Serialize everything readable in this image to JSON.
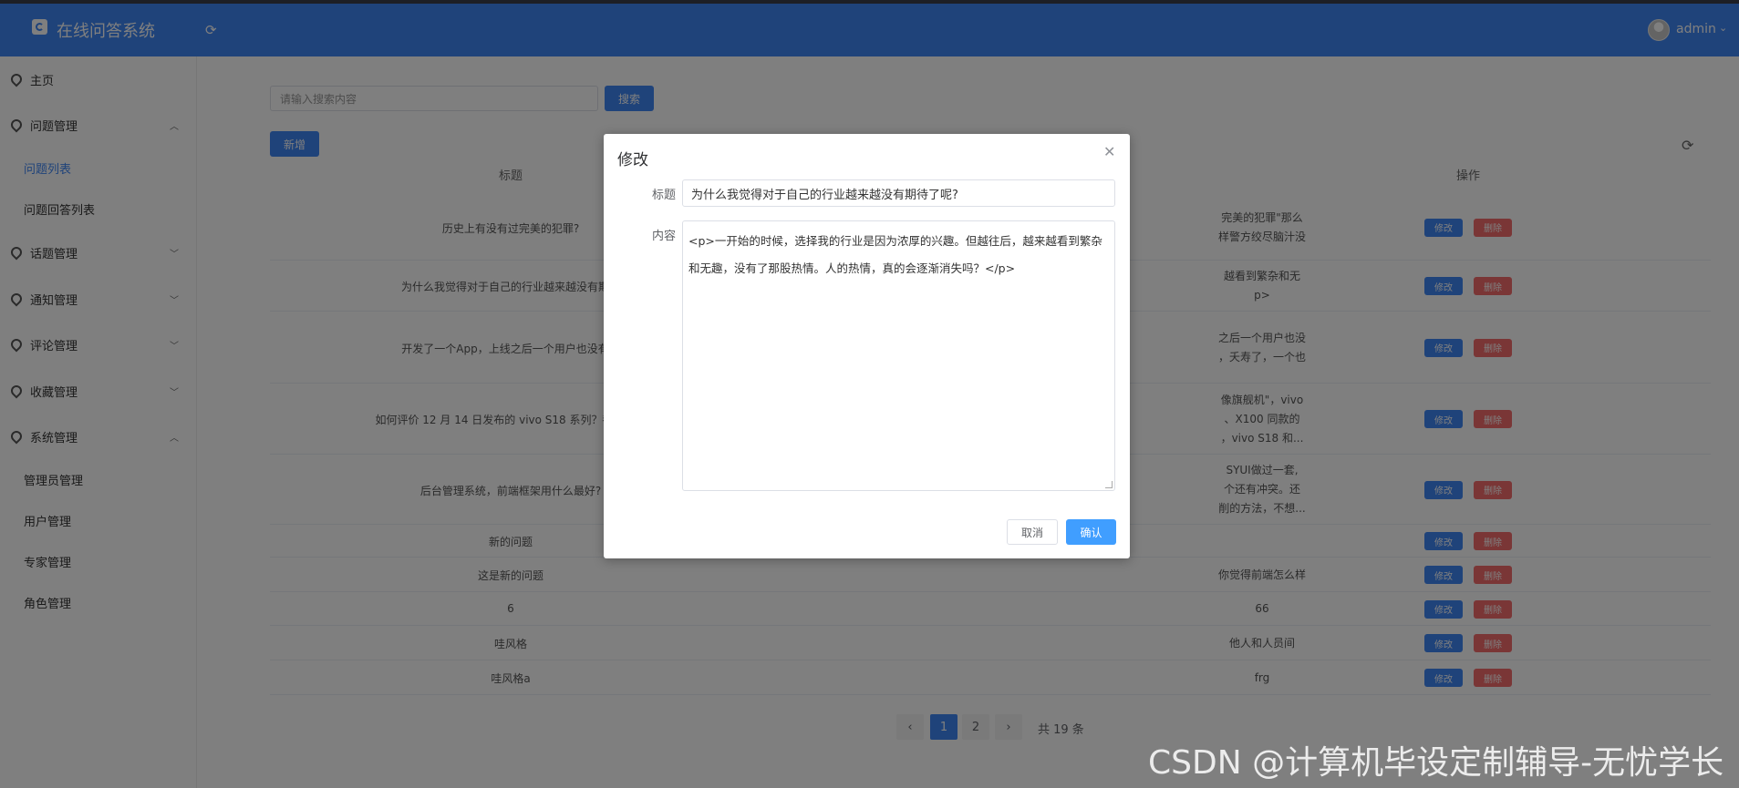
{
  "header": {
    "app_title": "在线问答系统",
    "user_name": "admin"
  },
  "sidebar": {
    "items": [
      {
        "label": "主页"
      },
      {
        "label": "问题管理"
      },
      {
        "label": "话题管理"
      },
      {
        "label": "通知管理"
      },
      {
        "label": "评论管理"
      },
      {
        "label": "收藏管理"
      },
      {
        "label": "系统管理"
      }
    ],
    "question_sub": [
      "问题列表",
      "问题回答列表"
    ],
    "system_sub": [
      "管理员管理",
      "用户管理",
      "专家管理",
      "角色管理"
    ]
  },
  "toolbar": {
    "search_placeholder": "请输入搜索内容",
    "search_label": "搜索",
    "add_label": "新增"
  },
  "table": {
    "headers": {
      "title": "标题",
      "operation": "操作"
    },
    "edit_label": "修改",
    "delete_label": "删除",
    "rows": [
      {
        "title": "历史上有没有过完美的犯罪?",
        "content": [
          "完美的犯罪\"那么",
          "样警方绞尽脑汁没"
        ]
      },
      {
        "title": "为什么我觉得对于自己的行业越来越没有期待",
        "content": [
          "越看到繁杂和无",
          "p>"
        ]
      },
      {
        "title": "开发了一个App，上线之后一个用户也没有怎",
        "content": [
          "之后一个用户也没",
          "，夭寿了，一个也"
        ]
      },
      {
        "title": "如何评价 12 月 14 日发布的 vivo S18 系列？都有哪些",
        "content": [
          "像旗舰机\"，vivo",
          "、X100 同款的",
          "，vivo S18 和..."
        ]
      },
      {
        "title": "后台管理系统，前端框架用什么最好?",
        "content": [
          "SYUI做过一套,",
          "个还有冲突。还",
          "削的方法，不想..."
        ]
      },
      {
        "title": "新的问题",
        "content": []
      },
      {
        "title": "这是新的问题",
        "content": [
          "你觉得前端怎么样"
        ]
      },
      {
        "title": "6",
        "content": [
          "66"
        ]
      },
      {
        "title": "哇风格",
        "content": [
          "他人和人员间"
        ]
      },
      {
        "title": "哇风格a",
        "content": [
          "frg"
        ]
      }
    ]
  },
  "pagination": {
    "prev": "‹",
    "next": "›",
    "pages": [
      "1",
      "2"
    ],
    "current": 1,
    "total_text": "共 19 条"
  },
  "dialog": {
    "title": "修改",
    "title_label": "标题",
    "title_value": "为什么我觉得对于自己的行业越来越没有期待了呢?",
    "content_label": "内容",
    "content_value": "<p>一开始的时候，选择我的行业是因为浓厚的兴趣。但越往后，越来越看到繁杂和无趣，没有了那股热情。人的热情，真的会逐渐消失吗？</p>",
    "cancel_label": "取消",
    "confirm_label": "确认"
  },
  "watermark": "CSDN @计算机毕设定制辅导-无忧学长",
  "colors": {
    "primary": "#3f86f5",
    "danger": "#f56c6c",
    "confirm": "#409eff"
  }
}
